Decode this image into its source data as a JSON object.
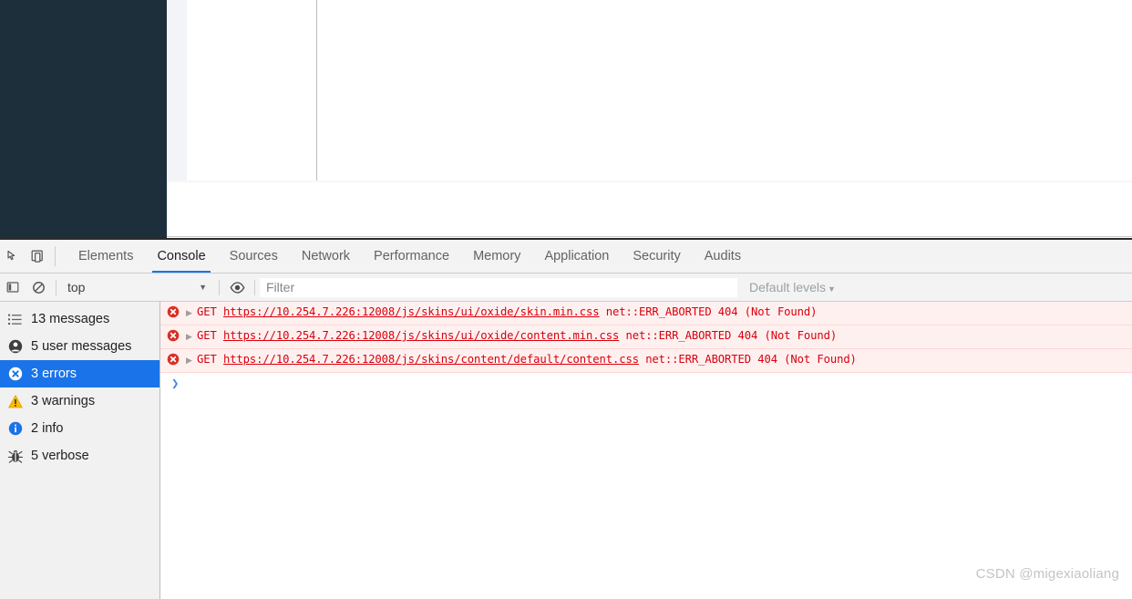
{
  "page": {
    "nav_background": "#1d2f3b",
    "panel_background": "#ffffff",
    "gutter_background": "#f3f4f8"
  },
  "devtools": {
    "toolbar": {
      "inspect_icon": "inspect-element-icon",
      "device_toolbar_icon": "device-toolbar-icon",
      "tabs": [
        {
          "label": "Elements",
          "active": false
        },
        {
          "label": "Console",
          "active": true
        },
        {
          "label": "Sources",
          "active": false
        },
        {
          "label": "Network",
          "active": false
        },
        {
          "label": "Performance",
          "active": false
        },
        {
          "label": "Memory",
          "active": false
        },
        {
          "label": "Application",
          "active": false
        },
        {
          "label": "Security",
          "active": false
        },
        {
          "label": "Audits",
          "active": false
        }
      ]
    },
    "filterbar": {
      "sidebar_toggle_icon": "console-sidebar-icon",
      "clear_icon": "clear-console-icon",
      "context_value": "top",
      "context_caret": "▼",
      "eye_icon": "live-expression-icon",
      "filter_placeholder": "Filter",
      "filter_value": "",
      "levels_label": "Default levels",
      "levels_caret": "▼"
    },
    "sidebar": {
      "items": [
        {
          "icon": "list-icon",
          "label": "13 messages",
          "selected": false
        },
        {
          "icon": "user-icon",
          "label": "5 user messages",
          "selected": false
        },
        {
          "icon": "error-icon",
          "label": "3 errors",
          "selected": true
        },
        {
          "icon": "warning-icon",
          "label": "3 warnings",
          "selected": false
        },
        {
          "icon": "info-icon",
          "label": "2 info",
          "selected": false
        },
        {
          "icon": "verbose-icon",
          "label": "5 verbose",
          "selected": false
        }
      ]
    },
    "messages": [
      {
        "level": "error",
        "expander": "▶",
        "method": "GET",
        "url": "https://10.254.7.226:12008/js/skins/ui/oxide/skin.min.css",
        "status": "net::ERR_ABORTED 404 (Not Found)"
      },
      {
        "level": "error",
        "expander": "▶",
        "method": "GET",
        "url": "https://10.254.7.226:12008/js/skins/ui/oxide/content.min.css",
        "status": "net::ERR_ABORTED 404 (Not Found)"
      },
      {
        "level": "error",
        "expander": "▶",
        "method": "GET",
        "url": "https://10.254.7.226:12008/js/skins/content/default/content.css",
        "status": "net::ERR_ABORTED 404 (Not Found)"
      }
    ],
    "prompt": {
      "caret": "❯"
    },
    "colors": {
      "accent": "#1a73e8",
      "error_text": "#d8000c",
      "error_row_bg": "#fff0f0",
      "sidebar_bg": "#f1f1f1",
      "toolbar_bg": "#f3f3f3"
    }
  },
  "watermark": {
    "text": "CSDN @migexiaoliang"
  }
}
